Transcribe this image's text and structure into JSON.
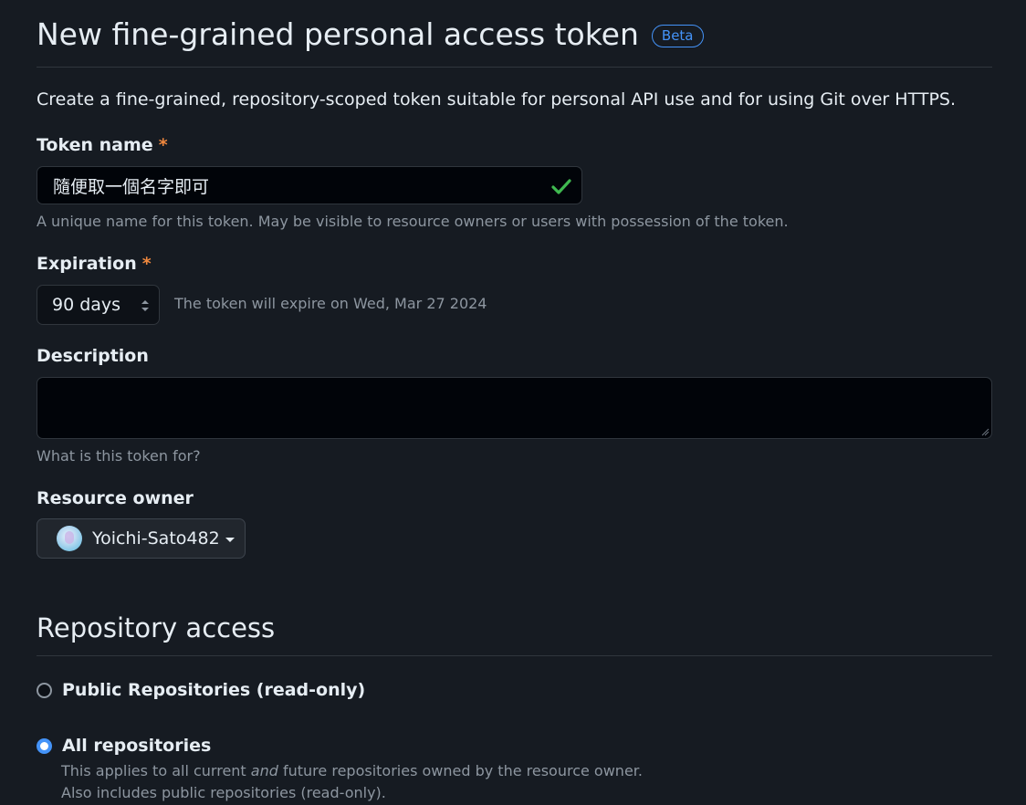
{
  "header": {
    "title": "New fine-grained personal access token",
    "badge": "Beta"
  },
  "intro": "Create a fine-grained, repository-scoped token suitable for personal API use and for using Git over HTTPS.",
  "token_name": {
    "label": "Token name",
    "required_mark": "*",
    "value": "隨便取一個名字即可",
    "valid": true,
    "hint": "A unique name for this token. May be visible to resource owners or users with possession of the token."
  },
  "expiration": {
    "label": "Expiration",
    "required_mark": "*",
    "selected": "90 days",
    "note": "The token will expire on Wed, Mar 27 2024"
  },
  "description": {
    "label": "Description",
    "value": "",
    "hint": "What is this token for?"
  },
  "resource_owner": {
    "label": "Resource owner",
    "selected": "Yoichi-Sato482"
  },
  "repository_access": {
    "title": "Repository access",
    "options": [
      {
        "label": "Public Repositories (read-only)",
        "checked": false
      },
      {
        "label": "All repositories",
        "checked": true,
        "desc_pre": "This applies to all current ",
        "desc_em": "and",
        "desc_post": " future repositories owned by the resource owner.",
        "desc_line2": "Also includes public repositories (read-only)."
      }
    ]
  },
  "colors": {
    "background": "#161b22",
    "accent": "#4493f8",
    "required": "#f0883e",
    "success": "#3fb950",
    "muted_text": "#8d96a0",
    "border": "#30363d"
  },
  "icons": {
    "valid": "check-icon",
    "select": "select-caret-icon",
    "dropdown": "triangle-down-icon"
  }
}
